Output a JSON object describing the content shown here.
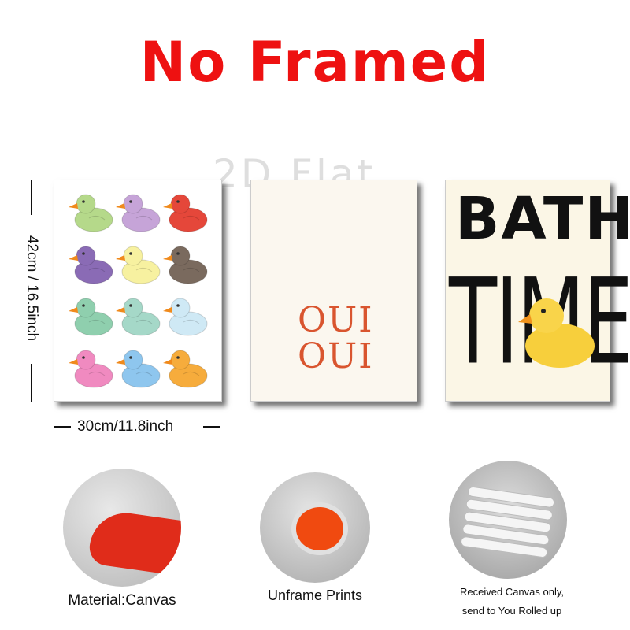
{
  "title": "No Framed",
  "watermark": "2D Flat",
  "dimensions": {
    "height_label": "42cm / 16.5inch",
    "width_label": "30cm/11.8inch"
  },
  "print2": {
    "line1": "OUI",
    "line2": "OUI"
  },
  "print3": {
    "line1": "BATH",
    "line2": "TIME"
  },
  "duck_colors": [
    "#b5d98a",
    "#c6a4d8",
    "#e5473a",
    "#8a6bb5",
    "#f7f1a0",
    "#7a6a5e",
    "#8fcfae",
    "#a5d8c8",
    "#cfe9f5",
    "#f08ac0",
    "#8ec6ee",
    "#f6ac3c"
  ],
  "captions": {
    "material": "Material:Canvas",
    "unframe": "Unframe  Prints",
    "received_1": "Received Canvas only,",
    "received_2": "send to You Rolled up"
  },
  "colors": {
    "title": "#ee1111",
    "oui": "#d9552f"
  }
}
